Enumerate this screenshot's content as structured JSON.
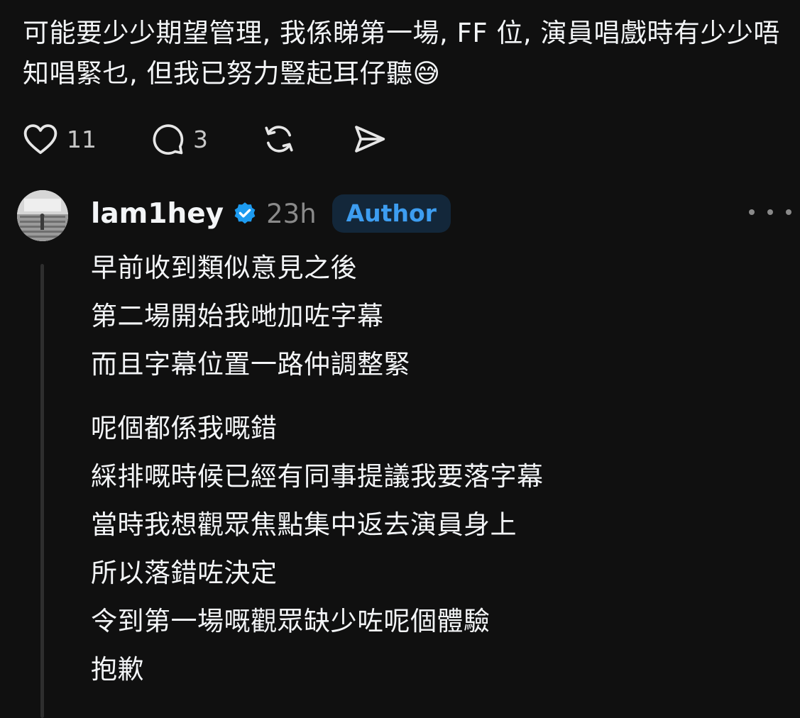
{
  "post": {
    "text": "可能要少少期望管理, 我係睇第一場, FF 位, 演員唱戲時有少少唔知唱緊乜, 但我已努力豎起耳仔聽😅",
    "likes": "11",
    "replies": "3"
  },
  "icons": {
    "like": "heart-icon",
    "reply": "comment-bubble-icon",
    "repost": "repost-icon",
    "share": "send-icon",
    "verified": "verified-badge-icon",
    "more": "more-horizontal-icon"
  },
  "reply": {
    "username": "lam1hey",
    "timestamp": "23h",
    "badge": "Author",
    "paragraph1": [
      "早前收到類似意見之後",
      "第二場開始我哋加咗字幕",
      "而且字幕位置一路仲調整緊"
    ],
    "paragraph2": [
      "呢個都係我嘅錯",
      "綵排嘅時候已經有同事提議我要落字幕",
      "當時我想觀眾焦點集中返去演員身上",
      "所以落錯咗決定",
      "令到第一場嘅觀眾缺少咗呢個體驗",
      "抱歉"
    ]
  },
  "colors": {
    "background": "#101010",
    "text": "#f3f5f7",
    "muted": "#8a8a8a",
    "verified": "#1d9bf0",
    "badge_bg": "#13273a",
    "badge_text": "#3d9df0"
  }
}
